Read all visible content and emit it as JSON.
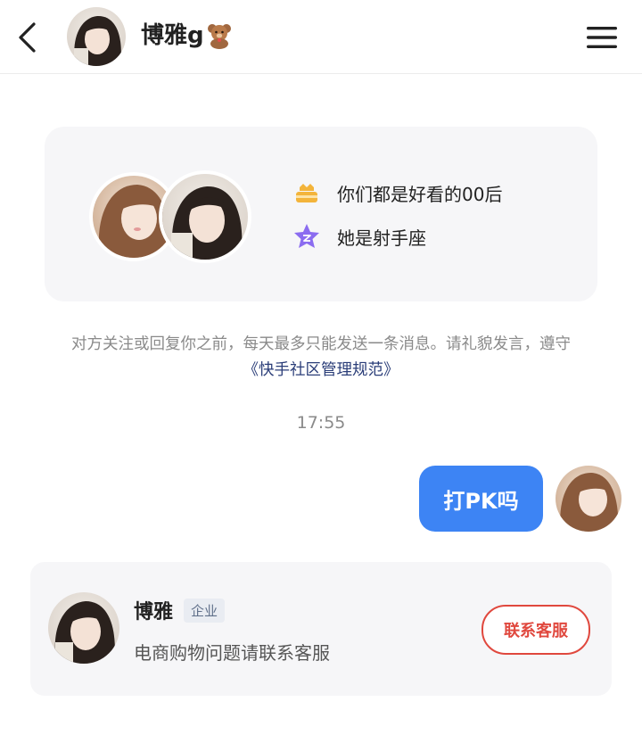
{
  "header": {
    "name": "博雅g",
    "icons": {
      "back": "back-arrow-icon",
      "emoji": "teddy-bear-icon",
      "menu": "hamburger-menu-icon"
    }
  },
  "profile_card": {
    "tags": [
      {
        "icon": "cake-icon",
        "text": "你们都是好看的00后"
      },
      {
        "icon": "star-zodiac-icon",
        "text": "她是射手座"
      }
    ]
  },
  "notice": {
    "text": "对方关注或回复你之前，每天最多只能发送一条消息。请礼貌发言，遵守",
    "link": "《快手社区管理规范》"
  },
  "chat": {
    "timestamp": "17:55",
    "messages": [
      {
        "sender": "me",
        "text": "打PK吗"
      }
    ]
  },
  "service_card": {
    "name": "博雅",
    "badge": "企业",
    "description": "电商购物问题请联系客服",
    "button_label": "联系客服"
  },
  "colors": {
    "bubble": "#3d84f4",
    "link": "#2a3d78",
    "contact_button": "#e0483e",
    "card_bg": "#f6f6f8",
    "cake": "#f3b43b",
    "star": "#8b6cf0"
  }
}
